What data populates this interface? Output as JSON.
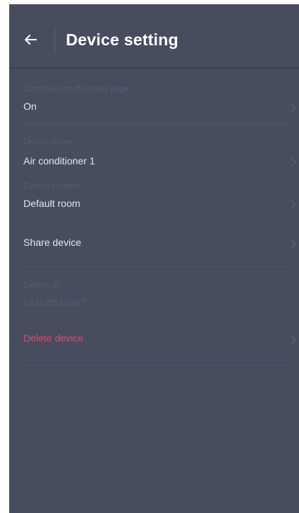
{
  "header": {
    "back_icon": "arrow-left-icon",
    "title": "Device setting"
  },
  "settings": {
    "main_page": {
      "caption": "Displayed on the main page",
      "value": "On"
    },
    "device_name": {
      "caption": "Device name",
      "value": "Air conditioner 1"
    },
    "device_location": {
      "caption": "Device location",
      "value": "Default room"
    },
    "share": {
      "value": "Share device"
    },
    "device_id": {
      "caption": "Device ID",
      "value": "ca2c4f5124e7"
    },
    "delete": {
      "value": "Delete device"
    }
  },
  "colors": {
    "background": "#474c5f",
    "text_primary": "#e4e6ee",
    "text_muted": "#575c6f",
    "danger": "#d64d6b",
    "separator": "#535869"
  }
}
